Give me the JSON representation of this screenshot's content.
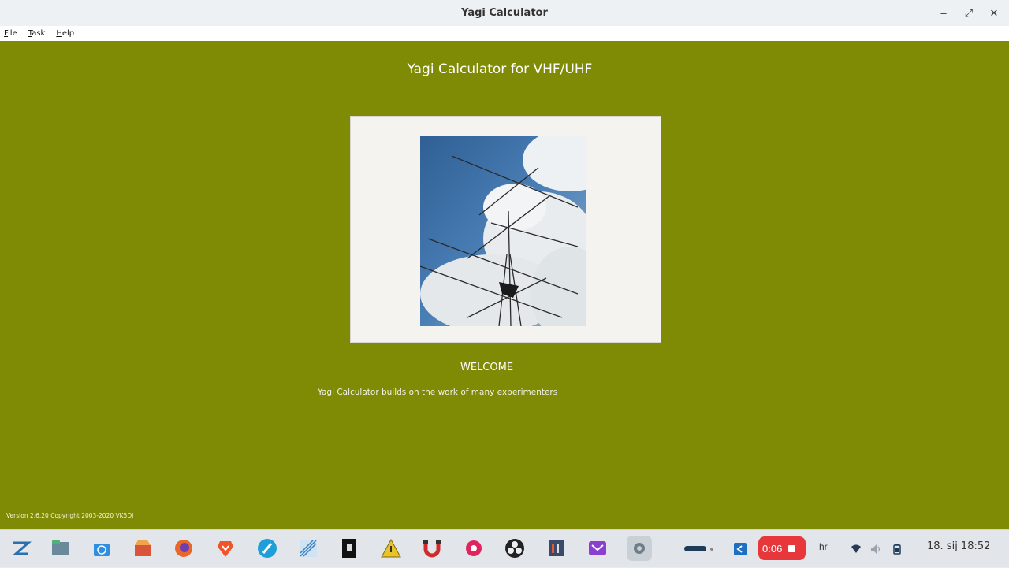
{
  "window": {
    "title": "Yagi Calculator",
    "controls": {
      "minimize": "–",
      "maximize": "⤢",
      "close": "✕"
    }
  },
  "menu": [
    {
      "accel": "F",
      "rest": "ile"
    },
    {
      "accel": "T",
      "rest": "ask"
    },
    {
      "accel": "H",
      "rest": "elp"
    }
  ],
  "main": {
    "heading": "Yagi Calculator  for VHF/UHF",
    "welcome": "WELCOME",
    "intro": "Yagi Calculator  builds on the work of many experimenters",
    "version": "Version 2.6.20 Copyright 2003-2020 VK5DJ"
  },
  "colors": {
    "background": "#7f8a05",
    "panel": "#f4f3f0",
    "sky": "#3f6fa3",
    "record": "#e8373b"
  },
  "taskbar": {
    "apps": [
      "zorin-menu-icon",
      "files-icon",
      "software-store-icon",
      "app-store-icon",
      "firefox-icon",
      "brave-icon",
      "browser-icon",
      "drawing-tool-icon",
      "terminal-app-icon",
      "warning-app-icon",
      "magnet-icon",
      "record-app-icon",
      "obs-icon",
      "settings-app-icon",
      "mail-icon",
      "running-app-icon"
    ],
    "record_time": "0:06",
    "language": "hr",
    "clock": "18. sij  18:52"
  }
}
